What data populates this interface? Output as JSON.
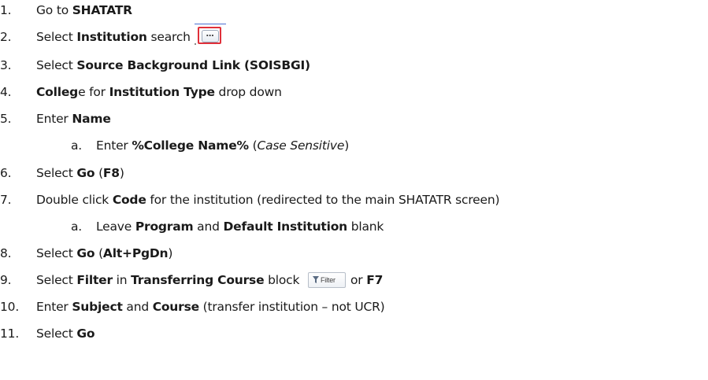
{
  "steps": [
    {
      "n": "1.",
      "t": [
        "Go to ",
        "SHATATR"
      ]
    },
    {
      "n": "2.",
      "t": [
        "Select ",
        "Institution",
        " search"
      ],
      "search_glyph": "…"
    },
    {
      "n": "3.",
      "t": [
        "Select ",
        "Source Background Link (SOISBGI)"
      ]
    },
    {
      "n": "4.",
      "t": [
        "Colleg",
        "e for ",
        "Institution Type",
        " drop down"
      ]
    },
    {
      "n": "5.",
      "t": [
        "Enter ",
        "Name"
      ]
    },
    {
      "n": "a.",
      "t": [
        "Enter ",
        "%College Name%",
        " (",
        "Case Sensitive",
        ")"
      ]
    },
    {
      "n": "6.",
      "t": [
        "Select ",
        "Go",
        " (",
        "F8",
        ")"
      ]
    },
    {
      "n": "7.",
      "t": [
        "Double click ",
        "Code",
        " for the institution (redirected to the main SHATATR screen)"
      ]
    },
    {
      "n": "a.",
      "t": [
        "Leave ",
        "Program",
        " and ",
        "Default Institution",
        " blank"
      ]
    },
    {
      "n": "8.",
      "t": [
        "Select ",
        "Go",
        " (",
        "Alt+PgDn",
        ")"
      ]
    },
    {
      "n": "9.",
      "t": [
        "Select ",
        "Filter",
        " in ",
        "Transferring Course",
        " block",
        "or ",
        "F7"
      ],
      "filter_label": "Filter"
    },
    {
      "n": "10.",
      "t": [
        "Enter ",
        "Subject",
        " and ",
        "Course",
        " (transfer institution – not UCR)"
      ]
    },
    {
      "n": "11.",
      "t": [
        "Select ",
        "Go"
      ]
    }
  ],
  "colors": {
    "highlight_border": "#e0303a",
    "text": "#1a1a1a"
  },
  "icons": {
    "search_button": "ellipsis-search-icon",
    "filter_button": "filter-funnel-icon"
  }
}
